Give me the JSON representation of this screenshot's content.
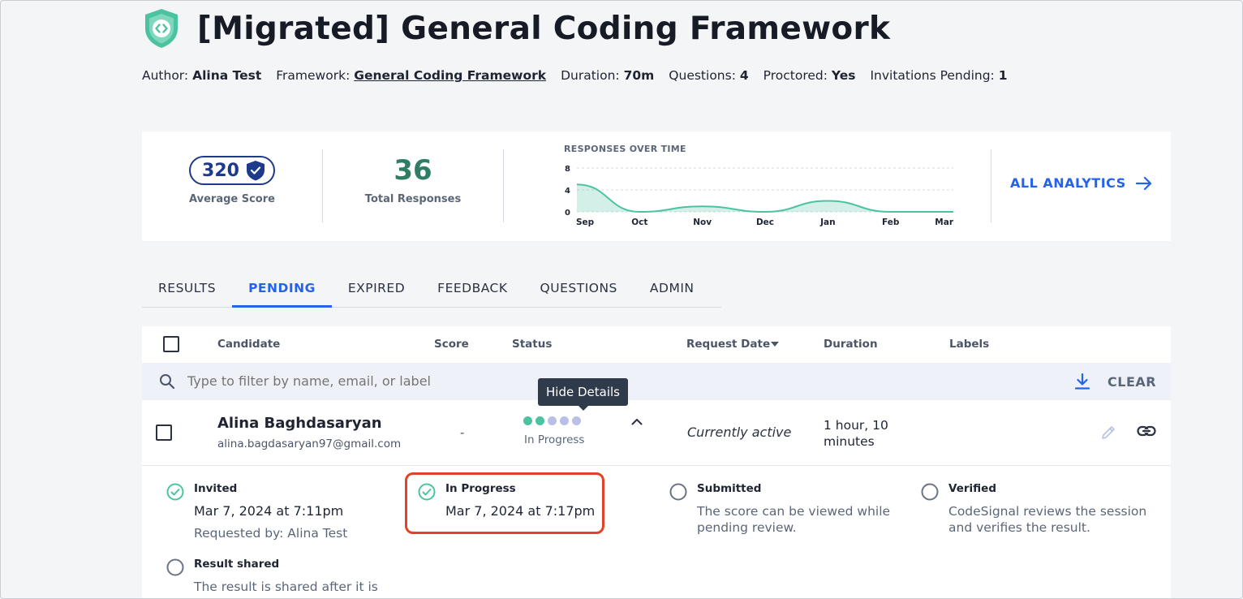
{
  "header": {
    "title": "[Migrated] General Coding Framework",
    "logo_color": "#4cc3a0"
  },
  "meta": {
    "author_label": "Author:",
    "author": "Alina Test",
    "framework_label": "Framework:",
    "framework": "General Coding Framework",
    "duration_label": "Duration:",
    "duration": "70m",
    "questions_label": "Questions:",
    "questions": "4",
    "proctored_label": "Proctored:",
    "proctored": "Yes",
    "invitations_label": "Invitations Pending:",
    "invitations": "1"
  },
  "stats": {
    "average_score": "320",
    "average_score_label": "Average Score",
    "total_responses": "36",
    "total_responses_label": "Total Responses",
    "all_analytics_label": "ALL ANALYTICS"
  },
  "chart_data": {
    "type": "area",
    "title": "RESPONSES OVER TIME",
    "categories": [
      "Sep",
      "Oct",
      "Nov",
      "Dec",
      "Jan",
      "Feb",
      "Mar"
    ],
    "values": [
      5,
      0,
      1,
      0,
      2,
      0,
      0
    ],
    "yticks": [
      "0",
      "4",
      "8"
    ],
    "ylim": [
      0,
      8
    ],
    "color": "#4cc3a0",
    "grid": true
  },
  "tabs": [
    {
      "label": "RESULTS",
      "active": false
    },
    {
      "label": "PENDING",
      "active": true
    },
    {
      "label": "EXPIRED",
      "active": false
    },
    {
      "label": "FEEDBACK",
      "active": false
    },
    {
      "label": "QUESTIONS",
      "active": false
    },
    {
      "label": "ADMIN",
      "active": false
    }
  ],
  "table": {
    "columns": {
      "candidate": "Candidate",
      "score": "Score",
      "status": "Status",
      "request_date": "Request Date",
      "duration": "Duration",
      "labels": "Labels"
    },
    "filter_placeholder": "Type to filter by name, email, or label",
    "clear_label": "CLEAR",
    "rows": [
      {
        "name": "Alina Baghdasaryan",
        "email": "alina.bagdasaryan97@gmail.com",
        "score": "-",
        "status": "In Progress",
        "progress_filled": 2,
        "progress_total": 5,
        "request_date": "Currently active",
        "duration": "1 hour, 10 minutes",
        "tooltip": "Hide Details"
      }
    ]
  },
  "details": {
    "invited": {
      "title": "Invited",
      "date": "Mar 7, 2024 at 7:11pm",
      "sub": "Requested by: Alina Test"
    },
    "in_progress": {
      "title": "In Progress",
      "date": "Mar 7, 2024 at 7:17pm"
    },
    "submitted": {
      "title": "Submitted",
      "desc": "The score can be viewed while pending review."
    },
    "verified": {
      "title": "Verified",
      "desc": "CodeSignal reviews the session and verifies the result."
    },
    "result_shared": {
      "title": "Result shared",
      "desc": "The result is shared after it is"
    }
  }
}
